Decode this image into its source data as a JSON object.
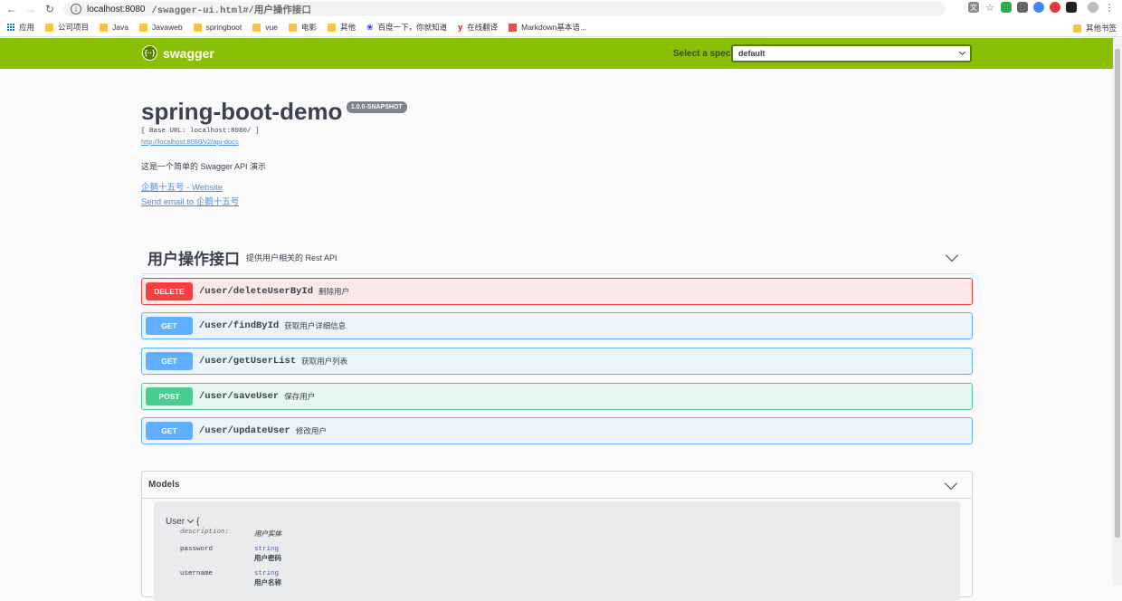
{
  "browser": {
    "url_host": "localhost:8080",
    "url_path": "/swagger-ui.html#/用户操作接口"
  },
  "bookmarks": {
    "apps_label": "应用",
    "items": [
      "公司项目",
      "Java",
      "Javaweb",
      "springboot",
      "vue",
      "电影",
      "其他",
      "百度一下，你就知道",
      "在线翻译",
      "Markdown基本语..."
    ],
    "other_label": "其他书签"
  },
  "topbar": {
    "logo_text": "swagger",
    "spec_label": "Select a spec",
    "spec_value": "default"
  },
  "info": {
    "title": "spring-boot-demo",
    "version": "1.0.0-SNAPSHOT",
    "base_url": "[ Base URL: localhost:8080/ ]",
    "api_docs_link": "http://localhost:8080/v2/api-docs",
    "description": "这是一个简单的 Swagger API 演示",
    "website_link": "企鹅十五号 - Website",
    "email_link": "Send email to 企鹅十五号"
  },
  "tag": {
    "name": "用户操作接口",
    "description": "提供用户相关的 Rest API"
  },
  "operations": [
    {
      "method": "DELETE",
      "path": "/user/deleteUserById",
      "summary": "删除用户"
    },
    {
      "method": "GET",
      "path": "/user/findById",
      "summary": "获取用户详细信息"
    },
    {
      "method": "GET",
      "path": "/user/getUserList",
      "summary": "获取用户列表"
    },
    {
      "method": "POST",
      "path": "/user/saveUser",
      "summary": "保存用户"
    },
    {
      "method": "GET",
      "path": "/user/updateUser",
      "summary": "修改用户"
    }
  ],
  "models": {
    "title": "Models",
    "model_name": "User",
    "open_brace": "{",
    "desc_key": "description:",
    "desc_value": "用户实体",
    "props": [
      {
        "name": "password",
        "type": "string",
        "desc": "用户密码"
      },
      {
        "name": "username",
        "type": "string",
        "desc": "用户名称"
      }
    ]
  }
}
